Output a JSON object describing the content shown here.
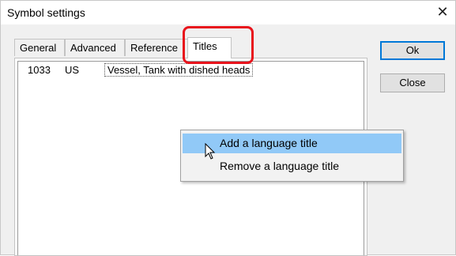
{
  "window": {
    "title": "Symbol settings",
    "close_glyph": "✕"
  },
  "tabs": [
    {
      "label": "General"
    },
    {
      "label": "Advanced"
    },
    {
      "label": "Reference"
    },
    {
      "label": "Titles",
      "active": true
    }
  ],
  "titles_list": {
    "rows": [
      {
        "code": "1033",
        "lang": "US",
        "title": "Vessel, Tank with dished heads"
      }
    ]
  },
  "buttons": {
    "ok": "Ok",
    "close": "Close"
  },
  "context_menu": {
    "items": [
      {
        "label": "Add a language title",
        "hovered": true
      },
      {
        "label": "Remove a language title"
      }
    ]
  },
  "colors": {
    "highlight": "#e8141c",
    "menu_hover": "#91c9f7",
    "default_button": "#0078d7"
  },
  "icons": {
    "pointer": "arrow-pointer-icon"
  }
}
